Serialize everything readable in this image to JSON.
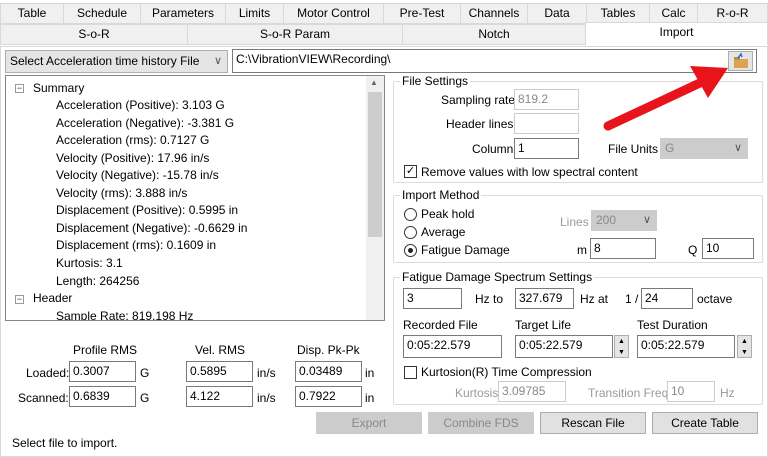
{
  "tabs_row1": [
    "Table",
    "Schedule",
    "Parameters",
    "Limits",
    "Motor Control",
    "Pre-Test",
    "Channels",
    "Data",
    "Tables",
    "Calc",
    "R-o-R"
  ],
  "tabs_row2": [
    "S-o-R",
    "S-o-R Param",
    "Notch",
    "Import"
  ],
  "active_tab": "Import",
  "file_type_select": "Select Acceleration time history File",
  "path_input": "C:\\VibrationVIEW\\Recording\\",
  "tree": {
    "summary_label": "Summary",
    "summary_items": [
      "Acceleration (Positive): 3.103 G",
      "Acceleration (Negative): -3.381 G",
      "Acceleration (rms): 0.7127 G",
      "Velocity (Positive): 17.96 in/s",
      "Velocity (Negative): -15.78 in/s",
      "Velocity (rms): 3.888 in/s",
      "Displacement (Positive): 0.5995 in",
      "Displacement (Negative): -0.6629 in",
      "Displacement (rms): 0.1609 in",
      "Kurtosis: 3.1",
      "Length: 264256"
    ],
    "header_label": "Header",
    "header_items": [
      "Sample Rate: 819.198 Hz"
    ]
  },
  "rms": {
    "headers": [
      "Profile RMS",
      "Vel. RMS",
      "Disp. Pk-Pk"
    ],
    "rows": [
      {
        "label": "Loaded:",
        "values": [
          "0.3007",
          "0.5895",
          "0.03489"
        ]
      },
      {
        "label": "Scanned:",
        "values": [
          "0.6839",
          "4.122",
          "0.7922"
        ]
      }
    ],
    "units": [
      "G",
      "in/s",
      "in"
    ]
  },
  "status": "Select file to import.",
  "file_settings": {
    "title": "File Settings",
    "sampling_rate_label": "Sampling rate",
    "sampling_rate": "819.2",
    "header_lines_label": "Header lines",
    "header_lines": "",
    "column_label": "Column",
    "column": "1",
    "file_units_label": "File Units",
    "file_units": "G",
    "remove_low_label": "Remove values with low spectral content",
    "remove_low_checked": true
  },
  "import_method": {
    "title": "Import Method",
    "options": [
      "Peak hold",
      "Average",
      "Fatigue Damage"
    ],
    "selected": "Fatigue Damage",
    "lines_label": "Lines",
    "lines": "200",
    "m_label": "m",
    "m": "8",
    "q_label": "Q",
    "q": "10"
  },
  "fds": {
    "title": "Fatigue Damage Spectrum Settings",
    "from": "3",
    "hz_to_label": "Hz to",
    "to": "327.679",
    "hz_at_label": "Hz at",
    "one_over": "1 /",
    "octave": "24",
    "octave_label": "octave",
    "recorded_label": "Recorded File",
    "recorded": "0:05:22.579",
    "target_label": "Target Life",
    "target": "0:05:22.579",
    "duration_label": "Test Duration",
    "duration": "0:05:22.579",
    "kurtosion_label": "Kurtosion(R) Time Compression",
    "kurtosion_checked": false,
    "kurtosis_label": "Kurtosis",
    "kurtosis": "3.09785",
    "transition_label": "Transition Freq",
    "transition": "10",
    "hz_label": "Hz"
  },
  "buttons": {
    "export": "Export",
    "combine": "Combine FDS",
    "rescan": "Rescan File",
    "create": "Create Table"
  },
  "colors": {
    "annotation_arrow": "#e8141b",
    "disabled": "#cccccc"
  }
}
